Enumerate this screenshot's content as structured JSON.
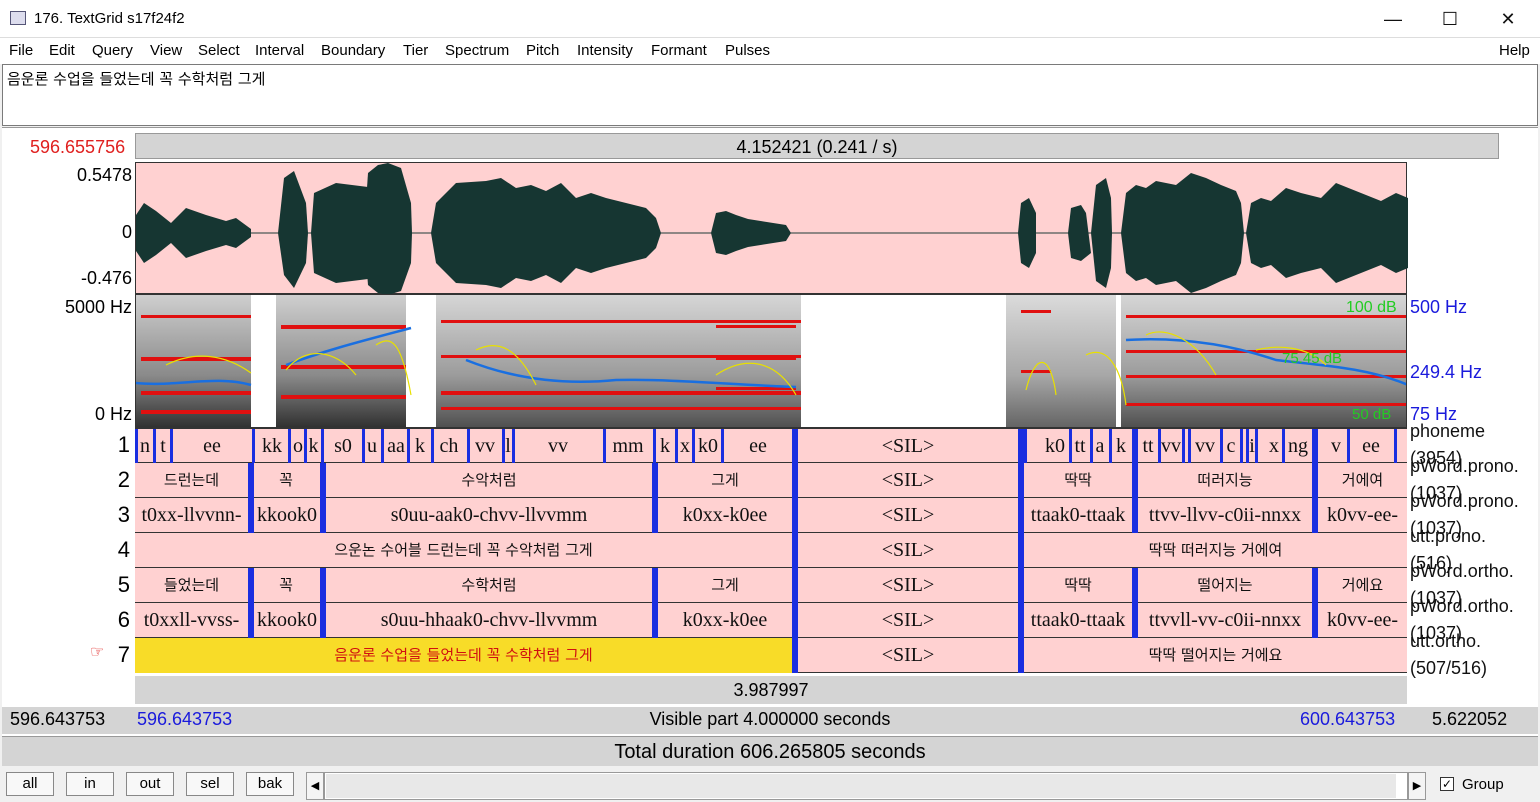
{
  "window": {
    "title": "176. TextGrid s17f24f2",
    "minimize_icon": "minimize-icon",
    "maximize_icon": "maximize-icon",
    "close_icon": "close-icon"
  },
  "menu": [
    "File",
    "Edit",
    "Query",
    "View",
    "Select",
    "Interval",
    "Boundary",
    "Tier",
    "Spectrum",
    "Pitch",
    "Intensity",
    "Formant",
    "Pulses"
  ],
  "help": "Help",
  "text_area": "음운론 수업을 들었는데 꼭 수학처럼 그게",
  "editor": {
    "cursor_left_time": "596.655756",
    "selection_label": "4.152421 (0.241 / s)",
    "wave_max": "0.5478",
    "wave_zero": "0",
    "wave_min": "-0.476",
    "spec_max": "5000 Hz",
    "spec_min": "0 Hz",
    "right_db": "100 dB",
    "right_hz_top": "500 Hz",
    "right_mid_a": "75.45 dB",
    "right_mid_b": "249.4 Hz",
    "right_hz_bottom": "75 Hz",
    "right_db_bottom": "50 dB",
    "cursor_time": "3.987997",
    "window_start": "596.643753",
    "visible_start": "596.643753",
    "visible_label": "Visible part 4.000000 seconds",
    "visible_end": "600.643753",
    "window_end": "5.622052",
    "total_label": "Total duration 606.265805 seconds",
    "selected_tier_marker": "☞"
  },
  "tiers": [
    {
      "num": "1",
      "name": "phoneme",
      "count": "(3954)"
    },
    {
      "num": "2",
      "name": "pWord.prono.",
      "count": "(1037)"
    },
    {
      "num": "3",
      "name": "pWord.prono.",
      "count": "(1037)"
    },
    {
      "num": "4",
      "name": "utt.prono.",
      "count": "(516)"
    },
    {
      "num": "5",
      "name": "pWord.ortho.",
      "count": "(1037)"
    },
    {
      "num": "6",
      "name": "pWord.ortho.",
      "count": "(1037)"
    },
    {
      "num": "7",
      "name": "utt.ortho.",
      "count": "(507/516)"
    }
  ],
  "tier_labels": {
    "t1": [
      "n",
      "t",
      "ee",
      "kk",
      "o",
      "k",
      "s0",
      "u",
      "aa",
      "k",
      "ch",
      "vv",
      "l",
      "vv",
      "mm",
      "k",
      "x",
      "k0",
      "ee",
      "<SIL>",
      "k0",
      "tt",
      "a",
      "k",
      "tt",
      "vv",
      "vv",
      "c",
      "i",
      "x",
      "ng",
      "v",
      "ee"
    ],
    "t2": [
      "드런는데",
      "꼭",
      "수악처럼",
      "그게",
      "<SIL>",
      "딱딱",
      "떠러지능",
      "거에여"
    ],
    "t3": [
      "t0xx-llvvnn-",
      "kkook0",
      "s0uu-aak0-chvv-llvvmm",
      "k0xx-k0ee",
      "<SIL>",
      "ttaak0-ttaak",
      "ttvv-llvv-c0ii-nnxx",
      "k0vv-ee-"
    ],
    "t4": [
      "으운논 수어블 드런는데 꼭 수악처럼 그게",
      "<SIL>",
      "딱딱 떠러지능 거에여"
    ],
    "t5": [
      "들었는데",
      "꼭",
      "수학처럼",
      "그게",
      "<SIL>",
      "딱딱",
      "떨어지는",
      "거에요"
    ],
    "t6": [
      "t0xxll-vvss-",
      "kkook0",
      "s0uu-hhaak0-chvv-llvvmm",
      "k0xx-k0ee",
      "<SIL>",
      "ttaak0-ttaak",
      "ttvvll-vv-c0ii-nnxx",
      "k0vv-ee-"
    ],
    "t7": [
      "음운론 수업을 들었는데 꼭 수학처럼 그게",
      "<SIL>",
      "딱딱 떨어지는 거에요"
    ]
  },
  "buttons": {
    "all": "all",
    "in": "in",
    "out": "out",
    "sel": "sel",
    "bak": "bak"
  },
  "group": {
    "label": "Group",
    "checked": true
  },
  "colors": {
    "tier_bg": "#ffd1d1",
    "boundary": "#1a2ee0",
    "selected": "#f8dc28",
    "formant": "#d01010",
    "pitch": "#1a6fe0",
    "intensity": "#e8e000"
  }
}
